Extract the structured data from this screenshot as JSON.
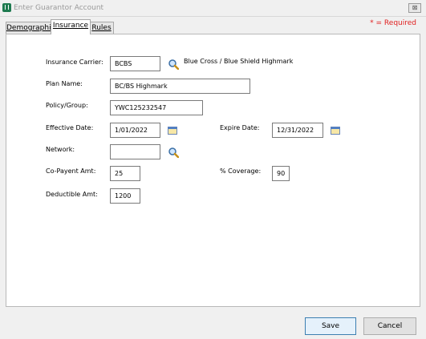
{
  "window": {
    "title": "Enter Guarantor Account",
    "close_label": "⊠"
  },
  "required_note": "* = Required",
  "tabs": [
    {
      "label": "Demographics"
    },
    {
      "label": "Insurance"
    },
    {
      "label": "Rules"
    }
  ],
  "form": {
    "insurance_carrier": {
      "label": "Insurance Carrier:",
      "value": "BCBS",
      "description": "Blue Cross / Blue Shield Highmark"
    },
    "plan_name": {
      "label": "Plan Name:",
      "value": "BC/BS Highmark"
    },
    "policy_group": {
      "label": "Policy/Group:",
      "value": "YWC125232547"
    },
    "effective_date": {
      "label": "Effective Date:",
      "value": "1/01/2022"
    },
    "expire_date": {
      "label": "Expire Date:",
      "value": "12/31/2022"
    },
    "network": {
      "label": "Network:",
      "value": ""
    },
    "copayment": {
      "label": "Co-Payent Amt:",
      "value": "25"
    },
    "coverage": {
      "label": "% Coverage:",
      "value": "90"
    },
    "deductible": {
      "label": "Deductible Amt:",
      "value": "1200"
    }
  },
  "buttons": {
    "save": "Save",
    "cancel": "Cancel"
  },
  "icons": {
    "lookup": "magnifier-icon",
    "calendar": "calendar-icon"
  }
}
